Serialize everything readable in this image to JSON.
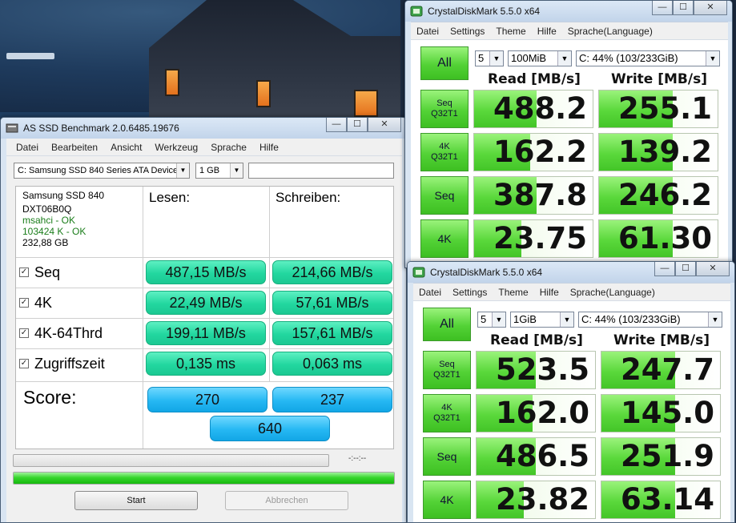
{
  "asssd": {
    "title": "AS SSD Benchmark 2.0.6485.19676",
    "menu": [
      "Datei",
      "Bearbeiten",
      "Ansicht",
      "Werkzeug",
      "Sprache",
      "Hilfe"
    ],
    "drive_select": "C: Samsung SSD 840 Series ATA Device",
    "size_select": "1 GB",
    "device": {
      "name": "Samsung SSD 840",
      "firmware": "DXT06B0Q",
      "driver": "msahci - OK",
      "alignment": "103424 K - OK",
      "capacity": "232,88 GB"
    },
    "col_read": "Lesen:",
    "col_write": "Schreiben:",
    "rows": [
      {
        "label": "Seq",
        "read": "487,15 MB/s",
        "write": "214,66 MB/s",
        "checked": true
      },
      {
        "label": "4K",
        "read": "22,49 MB/s",
        "write": "57,61 MB/s",
        "checked": true
      },
      {
        "label": "4K-64Thrd",
        "read": "199,11 MB/s",
        "write": "157,61 MB/s",
        "checked": true
      },
      {
        "label": "Zugriffszeit",
        "read": "0,135 ms",
        "write": "0,063 ms",
        "checked": true
      }
    ],
    "score_label": "Score:",
    "score_read": "270",
    "score_write": "237",
    "score_total": "640",
    "time": "-:--:--",
    "progress_top": 0,
    "progress_bottom": 1.0,
    "start_label": "Start",
    "abort_label": "Abbrechen"
  },
  "cdm1": {
    "title": "CrystalDiskMark 5.5.0 x64",
    "menu": [
      "Datei",
      "Settings",
      "Theme",
      "Hilfe",
      "Sprache(Language)"
    ],
    "all_label": "All",
    "count": "5",
    "size": "100MiB",
    "drive": "C: 44% (103/233GiB)",
    "read_head": "Read [MB/s]",
    "write_head": "Write [MB/s]",
    "rows": [
      {
        "l1": "Seq",
        "l2": "Q32T1",
        "read": "488.2",
        "write": "255.1"
      },
      {
        "l1": "4K",
        "l2": "Q32T1",
        "read": "162.2",
        "write": "139.2"
      },
      {
        "l1": "Seq",
        "l2": "",
        "read": "387.8",
        "write": "246.2"
      },
      {
        "l1": "4K",
        "l2": "",
        "read": "23.75",
        "write": "61.30"
      }
    ]
  },
  "cdm2": {
    "title": "CrystalDiskMark 5.5.0 x64",
    "menu": [
      "Datei",
      "Settings",
      "Theme",
      "Hilfe",
      "Sprache(Language)"
    ],
    "all_label": "All",
    "count": "5",
    "size": "1GiB",
    "drive": "C: 44% (103/233GiB)",
    "read_head": "Read [MB/s]",
    "write_head": "Write [MB/s]",
    "rows": [
      {
        "l1": "Seq",
        "l2": "Q32T1",
        "read": "523.5",
        "write": "247.7"
      },
      {
        "l1": "4K",
        "l2": "Q32T1",
        "read": "162.0",
        "write": "145.0"
      },
      {
        "l1": "Seq",
        "l2": "",
        "read": "486.5",
        "write": "251.9"
      },
      {
        "l1": "4K",
        "l2": "",
        "read": "23.82",
        "write": "63.14"
      }
    ]
  },
  "window_buttons": {
    "minimize": "—",
    "maximize": "☐",
    "close": "✕"
  }
}
